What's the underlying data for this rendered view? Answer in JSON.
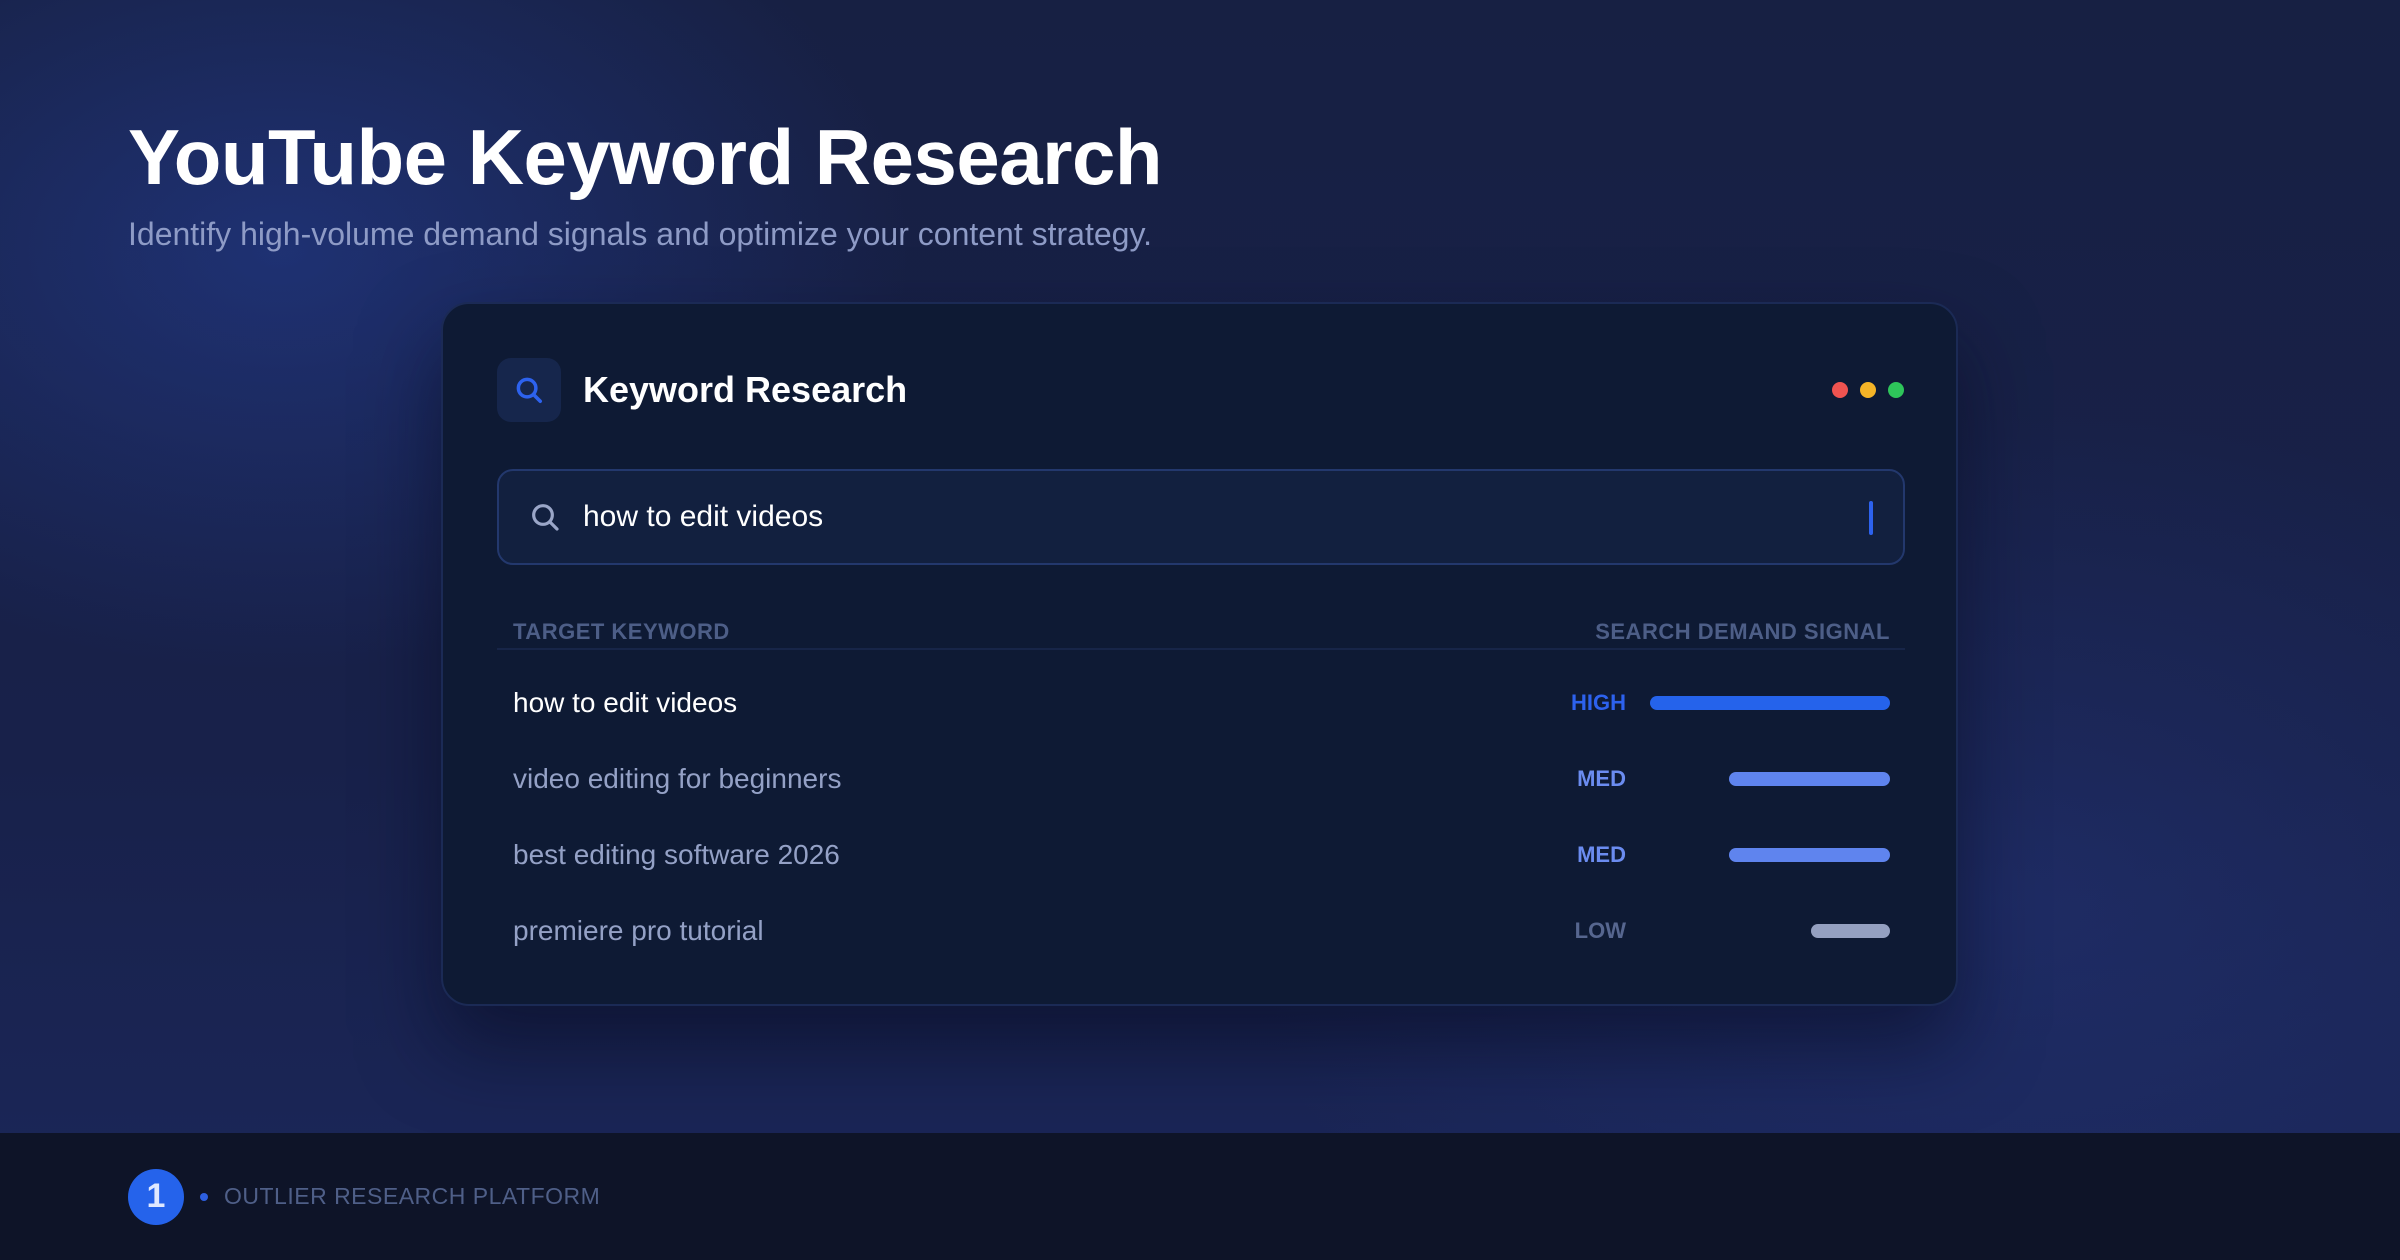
{
  "hero": {
    "title": "YouTube Keyword Research",
    "subtitle": "Identify high-volume demand signals and optimize your content strategy."
  },
  "card": {
    "title": "Keyword Research",
    "icon": "search-icon",
    "window_dots": [
      "#ef5350",
      "#f5b427",
      "#2ec55a"
    ]
  },
  "search": {
    "value": "how to edit videos",
    "icon": "search-icon"
  },
  "table": {
    "col_keyword": "TARGET KEYWORD",
    "col_signal": "SEARCH DEMAND SIGNAL",
    "rows": [
      {
        "keyword": "how to edit videos",
        "signal": "HIGH",
        "level": 1.0,
        "color": "#2563eb"
      },
      {
        "keyword": "video editing for beginners",
        "signal": "MED",
        "level": 0.67,
        "color": "#5f84ee"
      },
      {
        "keyword": "best editing software 2026",
        "signal": "MED",
        "level": 0.67,
        "color": "#5f84ee"
      },
      {
        "keyword": "premiere pro tutorial",
        "signal": "LOW",
        "level": 0.33,
        "color": "#94a0c0"
      }
    ]
  },
  "footer": {
    "logo_text": "1",
    "brand": "OUTLIER RESEARCH PLATFORM",
    "accent": "#2563eb"
  }
}
